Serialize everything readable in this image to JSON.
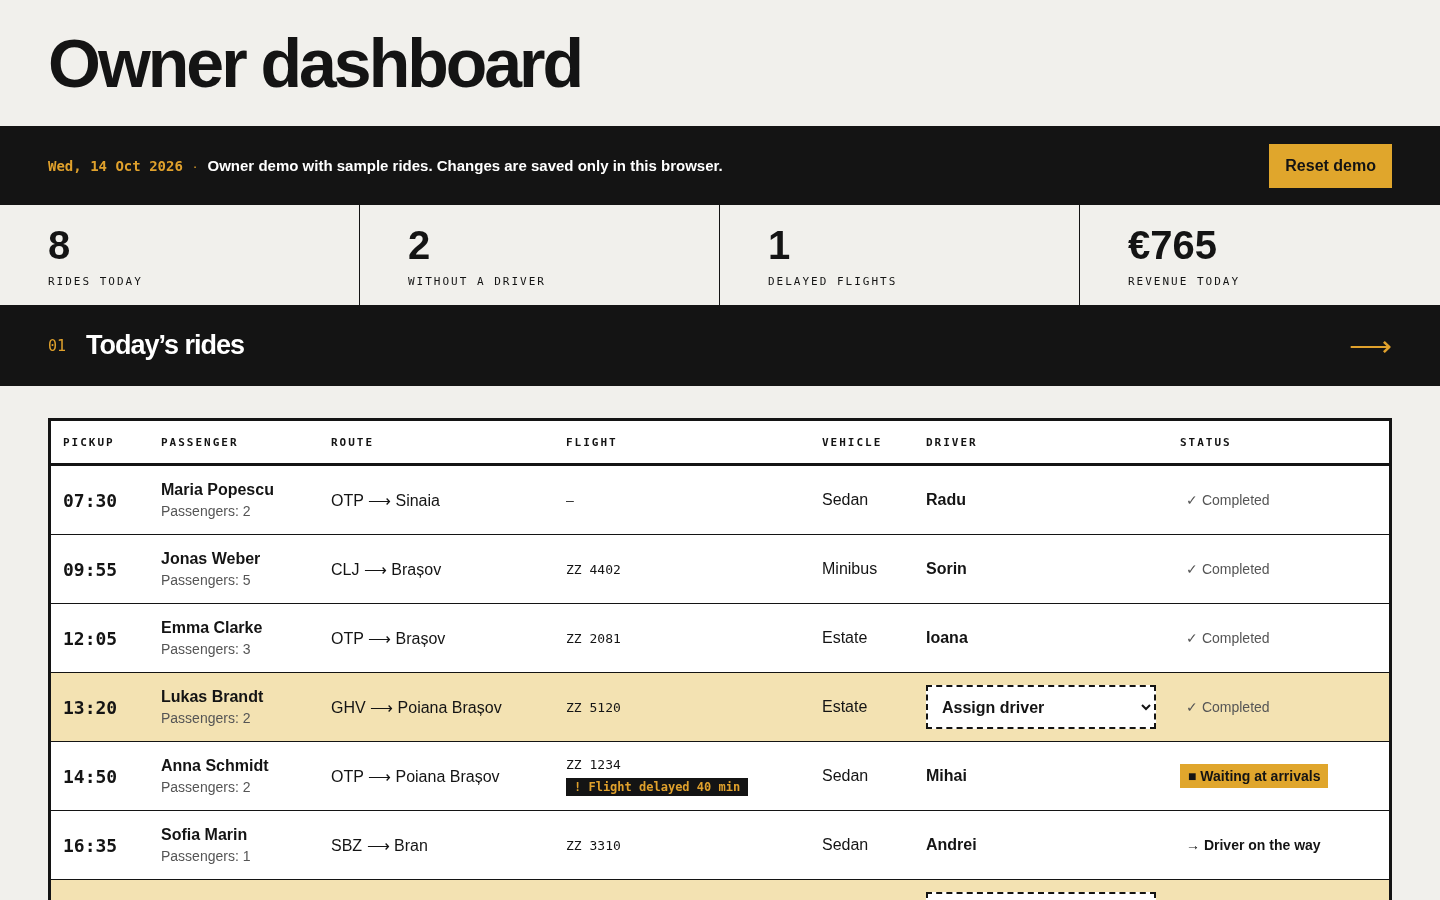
{
  "title": "Owner dashboard",
  "banner": {
    "date": "Wed, 14 Oct 2026",
    "separator": "·",
    "message": "Owner demo with sample rides. Changes are saved only in this browser.",
    "button": "Reset demo"
  },
  "stats": [
    {
      "value": "8",
      "label": "RIDES TODAY"
    },
    {
      "value": "2",
      "label": "WITHOUT A DRIVER"
    },
    {
      "value": "1",
      "label": "DELAYED FLIGHTS"
    },
    {
      "value": "€765",
      "label": "REVENUE TODAY"
    }
  ],
  "section": {
    "number": "01",
    "title": "Today’s rides",
    "arrow": "⟶"
  },
  "table": {
    "columns": [
      "PICKUP",
      "PASSENGER",
      "ROUTE",
      "FLIGHT",
      "VEHICLE",
      "DRIVER",
      "STATUS"
    ],
    "rows": [
      {
        "pickup": "07:30",
        "passenger": "Maria Popescu",
        "passengers": "Passengers: 2",
        "route": "OTP ⟶ Sinaia",
        "flight": "–",
        "vehicle": "Sedan",
        "driver": "Radu",
        "highlighted": false,
        "status": {
          "kind": "completed",
          "icon": "✓",
          "text": "Completed"
        }
      },
      {
        "pickup": "09:55",
        "passenger": "Jonas Weber",
        "passengers": "Passengers: 5",
        "route": "CLJ ⟶ Brașov",
        "flight": "ZZ 4402",
        "vehicle": "Minibus",
        "driver": "Sorin",
        "highlighted": false,
        "status": {
          "kind": "completed",
          "icon": "✓",
          "text": "Completed"
        }
      },
      {
        "pickup": "12:05",
        "passenger": "Emma Clarke",
        "passengers": "Passengers: 3",
        "route": "OTP ⟶ Brașov",
        "flight": "ZZ 2081",
        "vehicle": "Estate",
        "driver": "Ioana",
        "highlighted": false,
        "status": {
          "kind": "completed",
          "icon": "✓",
          "text": "Completed"
        }
      },
      {
        "pickup": "13:20",
        "passenger": "Lukas Brandt",
        "passengers": "Passengers: 2",
        "route": "GHV ⟶ Poiana Brașov",
        "flight": "ZZ 5120",
        "vehicle": "Estate",
        "driver_select": "Assign driver",
        "highlighted": true,
        "status": {
          "kind": "completed",
          "icon": "✓",
          "text": "Completed"
        }
      },
      {
        "pickup": "14:50",
        "passenger": "Anna Schmidt",
        "passengers": "Passengers: 2",
        "route": "OTP ⟶ Poiana Brașov",
        "flight": "ZZ 1234",
        "flight_alert": "! Flight delayed 40 min",
        "vehicle": "Sedan",
        "driver": "Mihai",
        "highlighted": false,
        "status": {
          "kind": "waiting",
          "icon": "■",
          "text": "Waiting at arrivals"
        }
      },
      {
        "pickup": "16:35",
        "passenger": "Sofia Marin",
        "passengers": "Passengers: 1",
        "route": "SBZ ⟶ Bran",
        "flight": "ZZ 3310",
        "vehicle": "Sedan",
        "driver": "Andrei",
        "highlighted": false,
        "status": {
          "kind": "on_the_way",
          "icon": "→",
          "text": "Driver on the way"
        }
      },
      {
        "highlighted": true
      }
    ]
  }
}
